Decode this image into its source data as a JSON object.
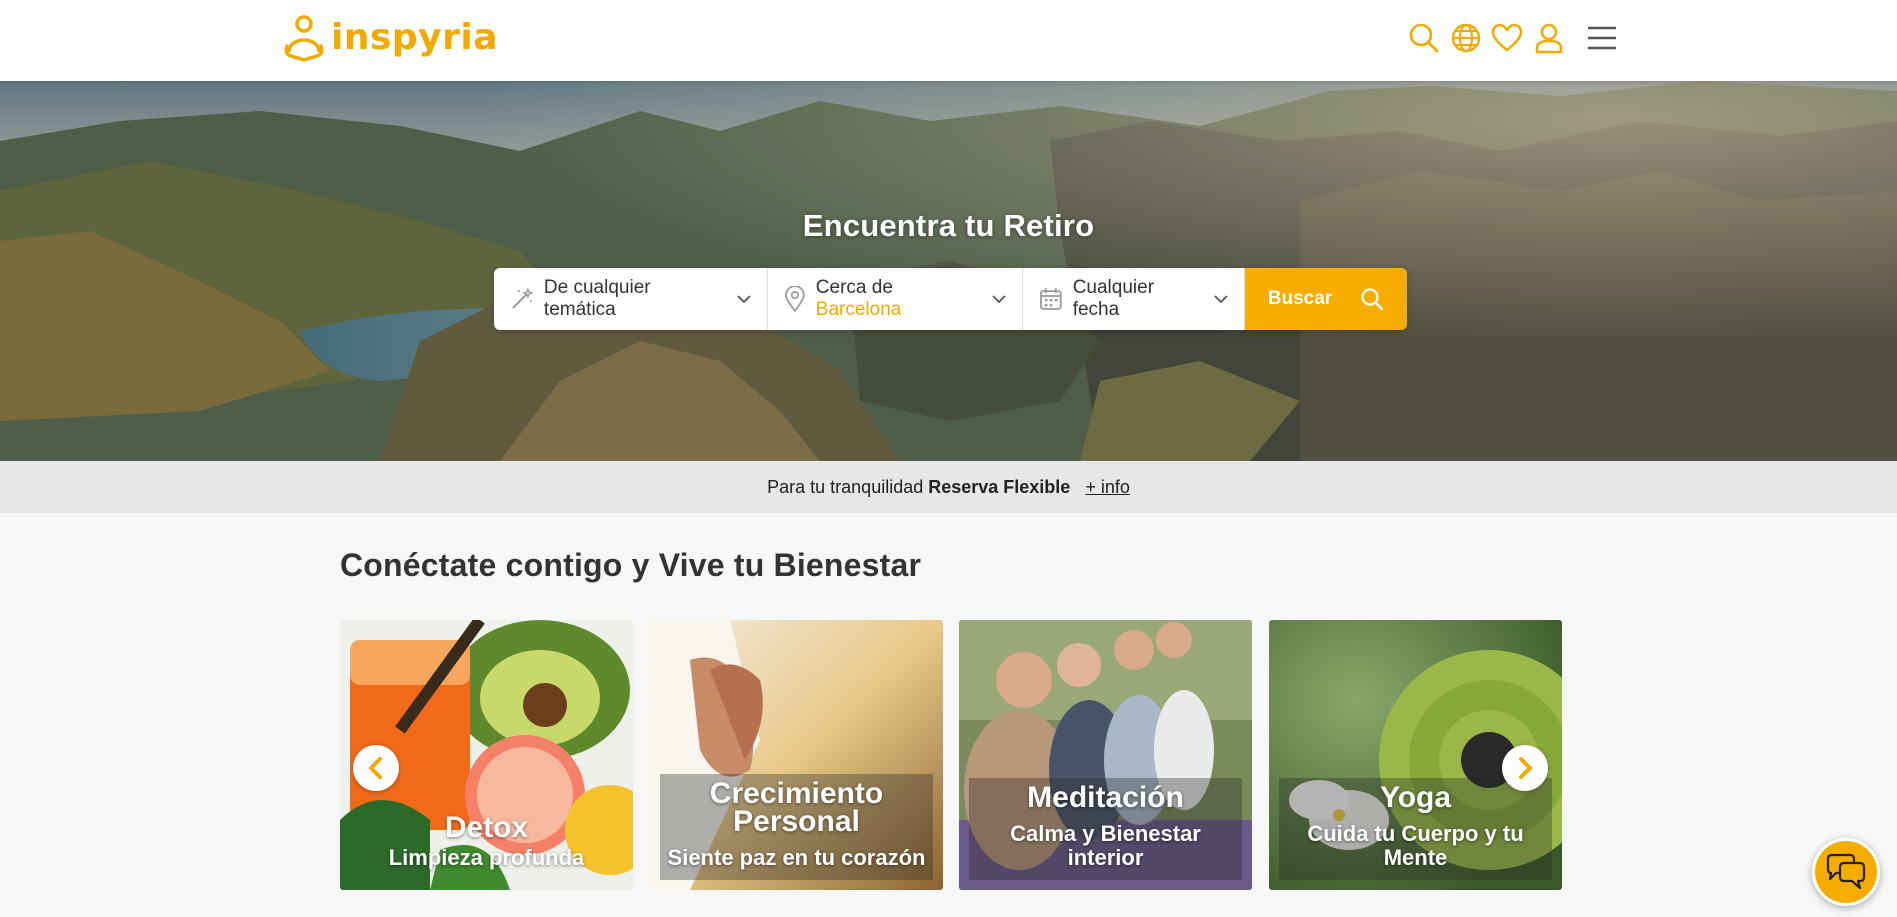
{
  "header": {
    "logo_text": "inspyria",
    "icons": [
      "search-icon",
      "globe-icon",
      "heart-icon",
      "user-icon",
      "menu-icon"
    ]
  },
  "hero": {
    "title": "Encuentra tu Retiro",
    "search": {
      "theme": "De cualquier temática",
      "location_prefix": "Cerca de",
      "location_city": "Barcelona",
      "date": "Cualquier fecha",
      "button": "Buscar"
    }
  },
  "flexible": {
    "prefix": "Para tu tranquilidad",
    "bold": "Reserva Flexible",
    "link": "+ info"
  },
  "section": {
    "title": "Conéctate contigo y Vive tu Bienestar",
    "cards": [
      {
        "title": "Detox",
        "subtitle": "Limpieza profunda"
      },
      {
        "title": "Crecimiento Personal",
        "subtitle": "Siente paz en tu corazón"
      },
      {
        "title": "Meditación",
        "subtitle": "Calma y Bienestar interior"
      },
      {
        "title": "Yoga",
        "subtitle": "Cuida tu Cuerpo y tu Mente"
      }
    ]
  },
  "colors": {
    "brand": "#f2a900",
    "button": "#f6ad00",
    "strip": "#e6e7e8"
  }
}
